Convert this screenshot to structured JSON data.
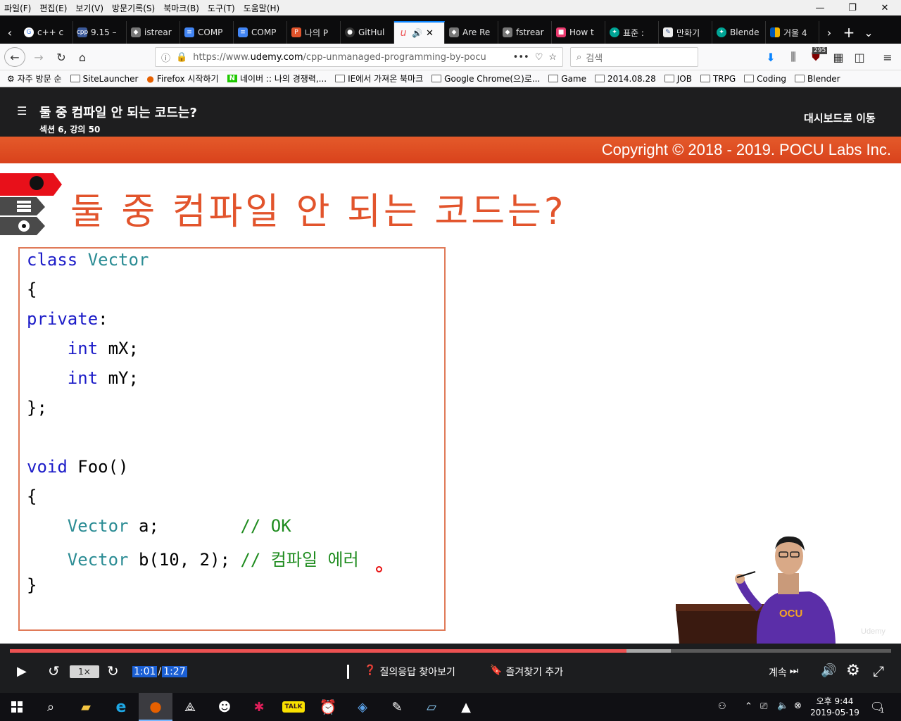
{
  "menubar": {
    "items": [
      "파일(F)",
      "편집(E)",
      "보기(V)",
      "방문기록(S)",
      "북마크(B)",
      "도구(T)",
      "도움말(H)"
    ]
  },
  "tabs": [
    {
      "label": "c++ c",
      "favicon": "google-icon",
      "color": "#4285f4"
    },
    {
      "label": "9.15 –",
      "favicon": "cpp-icon",
      "color": "#3c5a9a"
    },
    {
      "label": "istrear",
      "favicon": "cppreference-icon",
      "color": "#666"
    },
    {
      "label": "COMP",
      "favicon": "gdocs-icon",
      "color": "#4285f4"
    },
    {
      "label": "COMP",
      "favicon": "gdocs-icon",
      "color": "#4285f4"
    },
    {
      "label": "나의 P",
      "favicon": "pocu-icon",
      "color": "#e2542c"
    },
    {
      "label": "GitHul",
      "favicon": "github-icon",
      "color": "#333"
    },
    {
      "label": "",
      "favicon": "udemy-icon",
      "color": "#ec5252",
      "active": true
    },
    {
      "label": "Are Re",
      "favicon": "cppreference-icon",
      "color": "#666"
    },
    {
      "label": "fstrear",
      "favicon": "cppreference-icon",
      "color": "#666"
    },
    {
      "label": "How t",
      "favicon": "hackerrank-icon",
      "color": "#e9396d"
    },
    {
      "label": "표준 :",
      "favicon": "namu-icon",
      "color": "#00a495"
    },
    {
      "label": "만화기",
      "favicon": "comic-icon",
      "color": "#3b5998"
    },
    {
      "label": "Blende",
      "favicon": "namu-icon",
      "color": "#00a495"
    },
    {
      "label": "거울 4",
      "favicon": "flag-icon",
      "color": "#f2b400"
    }
  ],
  "navbar": {
    "url_prefix": "https://www.",
    "url_domain": "udemy.com",
    "url_rest": "/cpp-unmanaged-programming-by-pocu",
    "search_placeholder": "검색",
    "badge_count": "295"
  },
  "bookmarks": [
    {
      "label": "자주 방문 순",
      "icon": "gear-icon"
    },
    {
      "label": "SiteLauncher",
      "icon": "folder-icon"
    },
    {
      "label": "Firefox 시작하기",
      "icon": "firefox-icon"
    },
    {
      "label": "네이버 :: 나의 경쟁력,...",
      "icon": "naver-icon"
    },
    {
      "label": "IE에서 가져온 북마크",
      "icon": "folder-icon"
    },
    {
      "label": "Google Chrome(으)로...",
      "icon": "folder-icon"
    },
    {
      "label": "Game",
      "icon": "folder-icon"
    },
    {
      "label": "2014.08.28",
      "icon": "folder-icon"
    },
    {
      "label": "JOB",
      "icon": "folder-icon"
    },
    {
      "label": "TRPG",
      "icon": "folder-icon"
    },
    {
      "label": "Coding",
      "icon": "folder-icon"
    },
    {
      "label": "Blender",
      "icon": "folder-icon"
    }
  ],
  "course": {
    "lecture_title": "둘 중 컴파일 안 되는 코드는?",
    "section_info": "섹션 6, 강의 50",
    "dashboard_link": "대시보드로 이동"
  },
  "slide": {
    "copyright": "Copyright © 2018 - 2019. POCU Labs Inc.",
    "title": "둘 중 컴파일 안 되는 코드는?",
    "watermark": "Udemy",
    "shirt_logo": "OCU"
  },
  "code": {
    "l1_kw": "class",
    "l1_ty": "Vector",
    "l2": "{",
    "l3_kw": "private",
    "l3_rest": ":",
    "l4_ind": "    ",
    "l4_kw": "int",
    "l4_rest": " mX;",
    "l5_ind": "    ",
    "l5_kw": "int",
    "l5_rest": " mY;",
    "l6": "};",
    "l8_kw": "void",
    "l8_rest": " Foo()",
    "l9": "{",
    "l10_ind": "    ",
    "l10_ty": "Vector",
    "l10_rest": " a;        ",
    "l10_cm": "// OK",
    "l11_ind": "    ",
    "l11_ty": "Vector",
    "l11_rest": " b(10, 2); ",
    "l11_cm": "// 컴파일 에러",
    "l12": "}"
  },
  "player": {
    "speed": "1×",
    "current_time": "1:01",
    "separator": "/",
    "duration": "1:27",
    "played_fraction": 0.7,
    "buffered_fraction": 0.75,
    "qa_label": "질의응답 찾아보기",
    "bookmark_label": "즐겨찾기 추가",
    "continue_label": "계속",
    "accent": "#ec5252"
  },
  "taskbar": {
    "time": "오후 9:44",
    "date": "2019-05-19",
    "notification_count": "1",
    "apps": [
      "file-explorer-icon",
      "ie-icon",
      "firefox-icon",
      "unity-icon",
      "app-icon",
      "slack-icon",
      "kakaotalk-icon",
      "clock-icon",
      "visual-studio-icon",
      "paint-icon",
      "notebook-icon",
      "photos-icon"
    ]
  }
}
